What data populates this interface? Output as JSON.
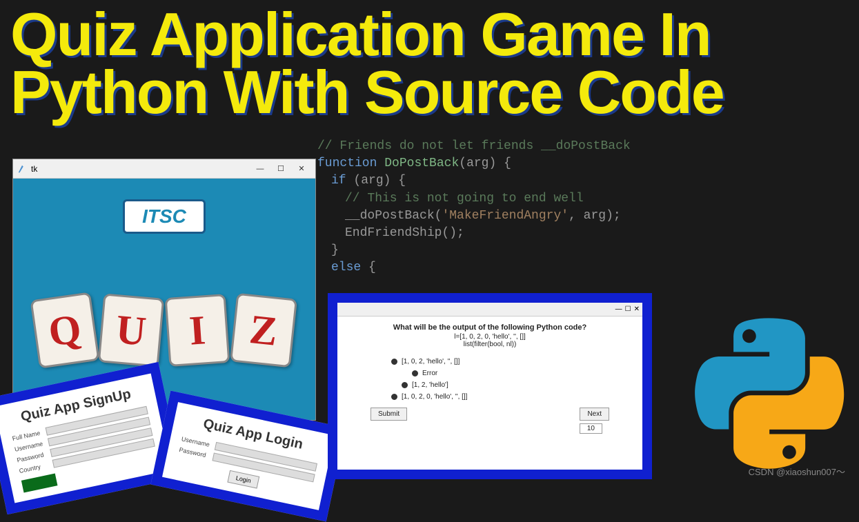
{
  "headline": "Quiz Application Game In Python With Source Code",
  "code": {
    "line0": "// Friends do not let friends __doPostBack",
    "line1a": "function",
    "line1b": "DoPostBack",
    "line1c": "(arg) {",
    "line2a": "if",
    "line2b": " (arg) {",
    "line3": "// This is not going to end well",
    "line4a": "__doPostBack(",
    "line4b": "'MakeFriendAngry'",
    "line4c": ", arg);",
    "line5": "EndFriendShip();",
    "line6": "}",
    "line7a": "else",
    "line7b": " {"
  },
  "tk": {
    "title": "tk",
    "itsc": "ITSC",
    "tiles": [
      "Q",
      "U",
      "I",
      "Z"
    ]
  },
  "signup": {
    "title": "Quiz App SignUp",
    "fields": [
      "Full Name",
      "Username",
      "Password",
      "Country"
    ],
    "btn": " "
  },
  "login": {
    "title": "Quiz App Login",
    "fields": [
      "Username",
      "Password"
    ],
    "btn": "Login"
  },
  "question": {
    "text": "What will be the output of the following Python code?",
    "sub1": "l=[1, 0, 2, 0, 'hello', '', []]",
    "sub2": "list(filter(bool, nl))",
    "options": [
      "[1, 0, 2, 'hello', '', []]",
      "Error",
      "[1, 2, 'hello']",
      "[1, 0, 2, 0, 'hello', '', []]"
    ],
    "submit": "Submit",
    "next": "Next",
    "score": "10"
  },
  "watermark": "CSDN @xiaoshun007～"
}
